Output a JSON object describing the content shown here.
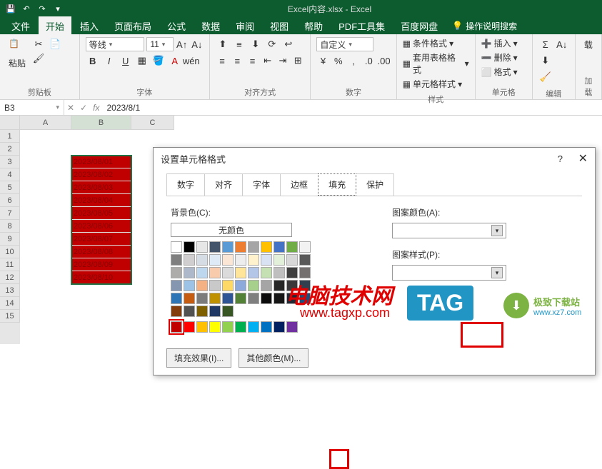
{
  "titlebar": {
    "title": "Excel内容.xlsx - Excel"
  },
  "tabs": {
    "file": "文件",
    "home": "开始",
    "insert": "插入",
    "layout": "页面布局",
    "formula": "公式",
    "data": "数据",
    "review": "审阅",
    "view": "视图",
    "help": "帮助",
    "pdf": "PDF工具集",
    "baidu": "百度网盘",
    "tell": "操作说明搜索"
  },
  "ribbon": {
    "clipboard": {
      "paste": "粘贴",
      "label": "剪贴板"
    },
    "font": {
      "name": "等线",
      "size": "11",
      "label": "字体"
    },
    "align": {
      "label": "对齐方式"
    },
    "number": {
      "format": "自定义",
      "label": "数字"
    },
    "styles": {
      "cond": "条件格式",
      "table": "套用表格格式",
      "cell": "单元格样式",
      "label": "样式"
    },
    "cells": {
      "insert": "插入",
      "delete": "删除",
      "format": "格式",
      "label": "单元格"
    },
    "editing": {
      "label": "编辑"
    },
    "addin": {
      "load": "载",
      "label": "加载"
    }
  },
  "namebox": "B3",
  "formula": "2023/8/1",
  "cols": [
    "A",
    "B",
    "C"
  ],
  "rows": [
    "1",
    "2",
    "3",
    "4",
    "5",
    "6",
    "7",
    "8",
    "9",
    "10",
    "11",
    "12",
    "13",
    "14",
    "15"
  ],
  "cells": [
    "2023/08/01",
    "2023/08/02",
    "2023/08/03",
    "2023/08/04",
    "2023/08/05",
    "2023/08/06",
    "2023/08/07",
    "2023/08/08",
    "2023/08/09",
    "2023/08/10"
  ],
  "dialog": {
    "title": "设置单元格格式",
    "help": "?",
    "tabs": {
      "number": "数字",
      "align": "对齐",
      "font": "字体",
      "border": "边框",
      "fill": "填充",
      "protect": "保护"
    },
    "bg_label": "背景色(C):",
    "no_color": "无颜色",
    "pattern_color": "图案颜色(A):",
    "pattern_style": "图案样式(P):",
    "fill_effects": "填充效果(I)...",
    "other_colors": "其他颜色(M)..."
  },
  "theme_colors": [
    "#ffffff",
    "#000000",
    "#e7e6e6",
    "#44546a",
    "#5b9bd5",
    "#ed7d31",
    "#a5a5a5",
    "#ffc000",
    "#4472c4",
    "#70ad47",
    "#f2f2f2",
    "#7f7f7f",
    "#d0cece",
    "#d6dce4",
    "#deebf6",
    "#fbe5d5",
    "#ededed",
    "#fff2cc",
    "#d9e2f3",
    "#e2efd9",
    "#d8d8d8",
    "#595959",
    "#aeabab",
    "#adb9ca",
    "#bdd7ee",
    "#f7cbac",
    "#dbdbdb",
    "#fee599",
    "#b4c6e7",
    "#c5e0b3",
    "#bfbfbf",
    "#3f3f3f",
    "#757070",
    "#8496b0",
    "#9cc3e5",
    "#f4b183",
    "#c9c9c9",
    "#ffd965",
    "#8eaadb",
    "#a8d08d",
    "#a5a5a5",
    "#262626",
    "#3a3838",
    "#323f4f",
    "#2e75b5",
    "#c55a11",
    "#7b7b7b",
    "#bf9000",
    "#2f5496",
    "#538135",
    "#7f7f7f",
    "#0c0c0c",
    "#171616",
    "#222a35",
    "#1e4e79",
    "#833c0b",
    "#525252",
    "#7f6000",
    "#1f3864",
    "#375623"
  ],
  "standard_colors": [
    "#c00000",
    "#ff0000",
    "#ffc000",
    "#ffff00",
    "#92d050",
    "#00b050",
    "#00b0f0",
    "#0070c0",
    "#002060",
    "#7030a0"
  ],
  "watermark": {
    "t1": "电脑技术网",
    "t2": "www.tagxp.com",
    "tag": "TAG",
    "dl1": "极致下载站",
    "dl2": "www.xz7.com"
  }
}
